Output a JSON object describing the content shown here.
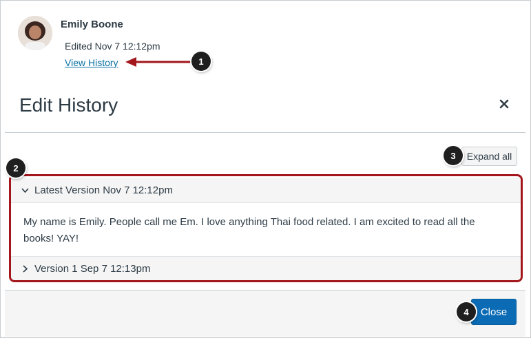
{
  "post": {
    "author_name": "Emily Boone",
    "edited_text": "Edited Nov 7 12:12pm",
    "view_history_label": "View History"
  },
  "modal": {
    "title": "Edit History",
    "close_icon": "close-icon",
    "expand_all_label": "Expand all",
    "versions": [
      {
        "label": "Latest Version Nov 7 12:12pm",
        "expanded": true,
        "body": "My name is Emily. People call me Em. I love anything Thai food related. I am excited to read all the books! YAY!"
      },
      {
        "label": "Version 1 Sep 7 12:13pm",
        "expanded": false
      }
    ],
    "close_button_label": "Close"
  },
  "callouts": [
    "1",
    "2",
    "3",
    "4"
  ],
  "colors": {
    "link": "#0770a3",
    "highlight": "#a3161c",
    "primary_button": "#0b6bb4",
    "callout": "#1f1f1f"
  }
}
